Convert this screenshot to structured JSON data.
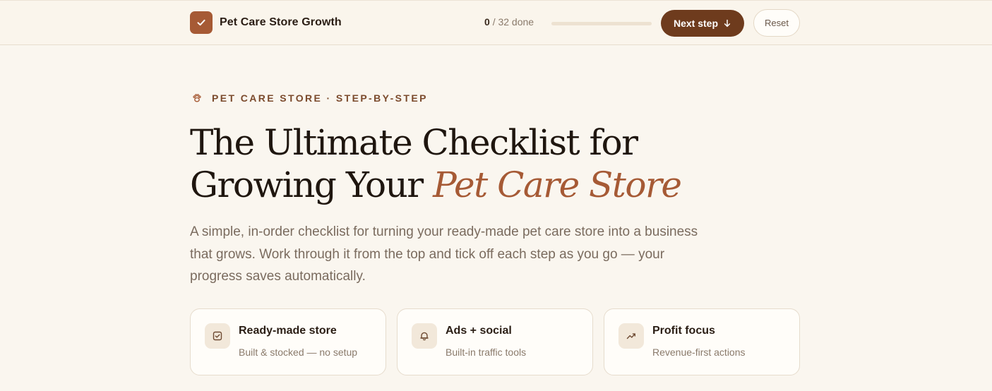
{
  "topbar": {
    "brand_title": "Pet Care Store Growth",
    "progress": {
      "done": "0",
      "total_label": "/ 32 done",
      "fraction": 0
    },
    "next_label": "Next step",
    "reset_label": "Reset"
  },
  "hero": {
    "eyebrow": "PET CARE STORE · STEP-BY-STEP",
    "headline_line1": "The Ultimate Checklist for",
    "headline_line2_prefix": "Growing Your",
    "headline_accent": "Pet Care Store",
    "lede": "A simple, in-order checklist for turning your ready-made pet care store into a business that grows. Work through it from the top and tick off each step as you go — your progress saves automatically."
  },
  "features": [
    {
      "icon": "checkbox-icon",
      "title": "Ready-made store",
      "subtitle": "Built & stocked — no setup"
    },
    {
      "icon": "bell-icon",
      "title": "Ads + social",
      "subtitle": "Built-in traffic tools"
    },
    {
      "icon": "trending-up-icon",
      "title": "Profit focus",
      "subtitle": "Revenue-first actions"
    }
  ],
  "colors": {
    "accent": "#a65a35",
    "primary_button": "#6e3b1d",
    "background": "#faf6ef"
  }
}
